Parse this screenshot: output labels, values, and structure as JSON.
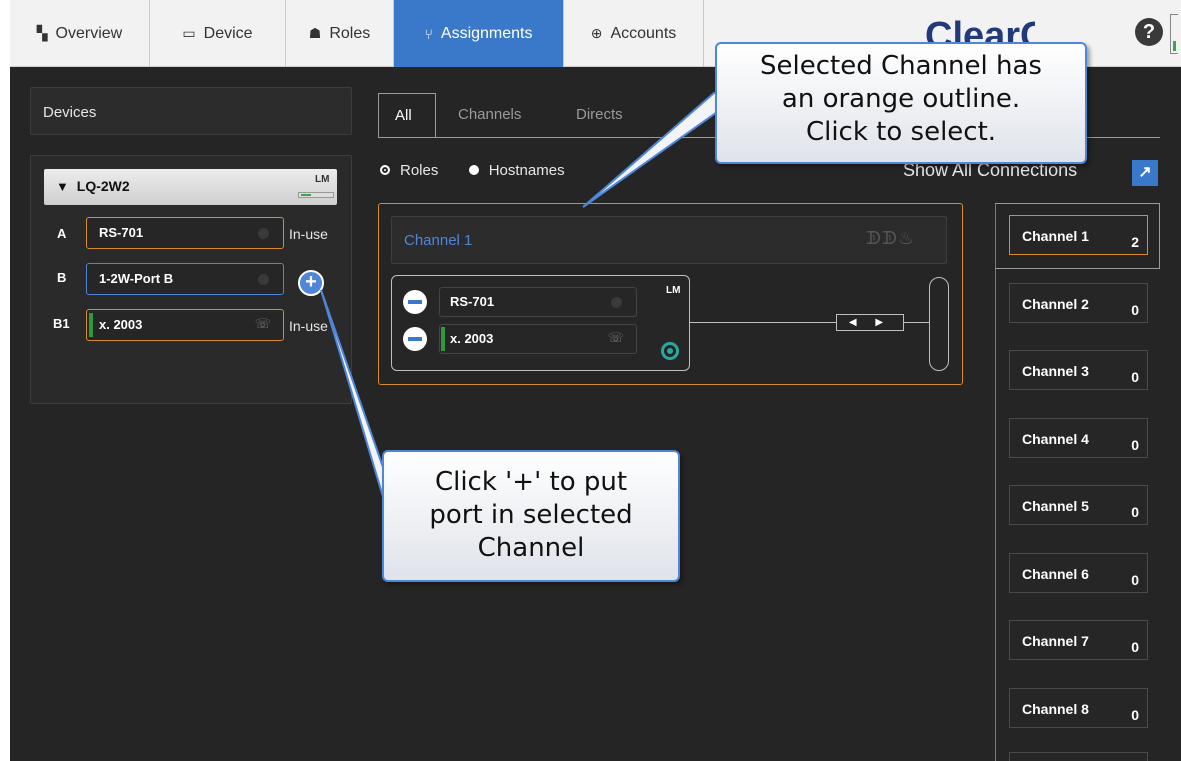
{
  "topnav": {
    "tabs": [
      {
        "label": "Overview",
        "icon": "grid-icon"
      },
      {
        "label": "Device",
        "icon": "device-icon"
      },
      {
        "label": "Roles",
        "icon": "roles-icon"
      },
      {
        "label": "Assignments",
        "icon": "assignments-icon",
        "active": true
      },
      {
        "label": "Accounts",
        "icon": "accounts-icon"
      }
    ],
    "logo_text": "ClearCom",
    "help_label": "?"
  },
  "devices": {
    "header": "Devices",
    "device_name": "LQ-2W2",
    "device_badge": "LM",
    "ports": [
      {
        "letter": "A",
        "name": "RS-701",
        "status": "In-use"
      },
      {
        "letter": "B",
        "name": "1-2W-Port B",
        "status": ""
      },
      {
        "letter": "B1",
        "name": "x. 2003",
        "status": "In-use"
      }
    ],
    "add_label": "+"
  },
  "subtabs": [
    {
      "label": "All",
      "active": true
    },
    {
      "label": "Channels"
    },
    {
      "label": "Directs"
    }
  ],
  "filters": {
    "roles_label": "Roles",
    "hostnames_label": "Hostnames",
    "show_all_label": "Show All Connections"
  },
  "channel_panel": {
    "title": "Channel 1",
    "badge": "LM",
    "members": [
      "RS-701",
      "x. 2003"
    ],
    "arrows": "◀ ▶"
  },
  "channels": [
    {
      "label": "Channel 1",
      "count": "2",
      "selected": true
    },
    {
      "label": "Channel 2",
      "count": "0"
    },
    {
      "label": "Channel 3",
      "count": "0"
    },
    {
      "label": "Channel 4",
      "count": "0"
    },
    {
      "label": "Channel 5",
      "count": "0"
    },
    {
      "label": "Channel 6",
      "count": "0"
    },
    {
      "label": "Channel 7",
      "count": "0"
    },
    {
      "label": "Channel 8",
      "count": "0"
    }
  ],
  "callouts": {
    "top": [
      "Selected Channel has",
      "an orange outline.",
      "Click to select."
    ],
    "bottom": [
      "Click '+' to put",
      "port in selected",
      "Channel"
    ]
  },
  "colors": {
    "accent_blue": "#3a78c9",
    "selection_orange": "#d98a2a",
    "background_dark": "#252525"
  }
}
